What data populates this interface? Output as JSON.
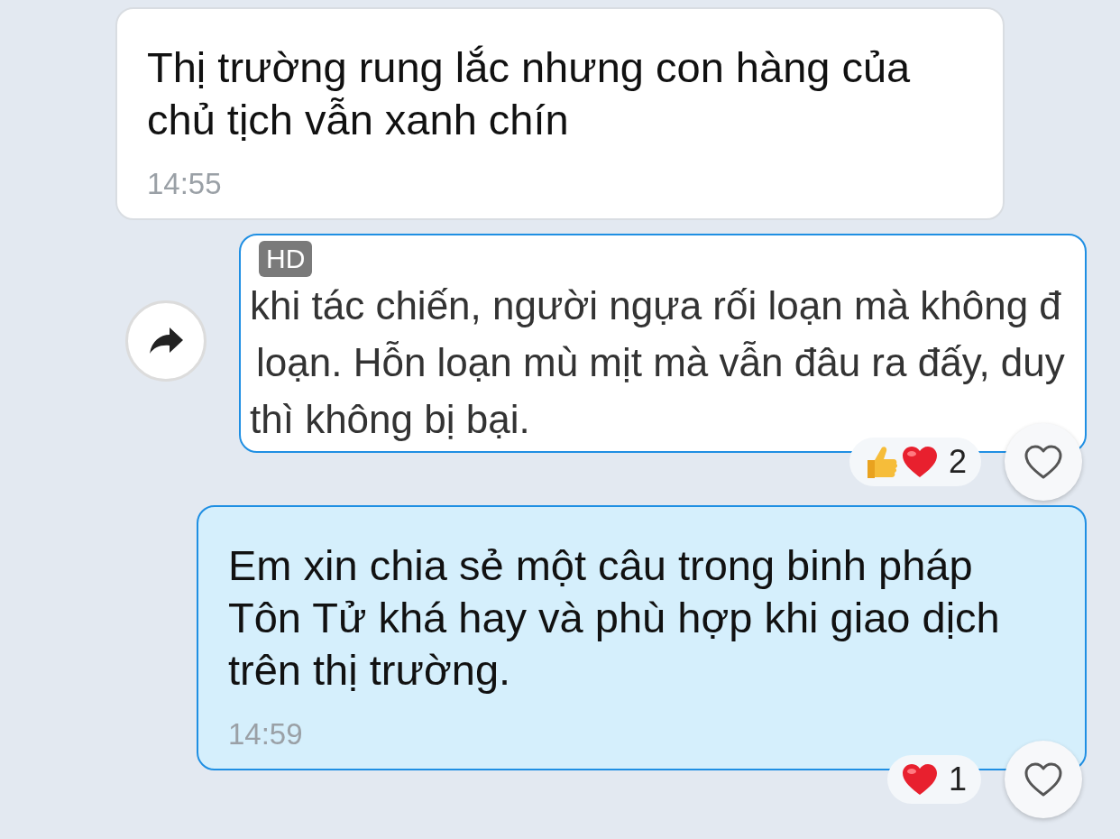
{
  "messages": [
    {
      "kind": "text",
      "outgoing": false,
      "text": "Thị trường rung lắc nhưng con hàng của chủ tịch vẫn xanh chín",
      "time": "14:55"
    },
    {
      "kind": "image",
      "badge": "HD",
      "lines": [
        "khi tác chiến, người ngựa rối loạn mà không đ",
        "loạn. Hỗn loạn mù mịt mà vẫn đâu ra đấy, duy",
        "thì không bị bại."
      ],
      "reactions": [
        {
          "kind": "like"
        },
        {
          "kind": "heart"
        }
      ],
      "reaction_count": "2"
    },
    {
      "kind": "text",
      "outgoing": true,
      "text": "Em xin chia sẻ một câu trong binh pháp Tôn Tử khá hay và phù hợp khi giao dịch trên thị trường.",
      "time": "14:59",
      "reactions": [
        {
          "kind": "heart"
        }
      ],
      "reaction_count": "1"
    }
  ]
}
